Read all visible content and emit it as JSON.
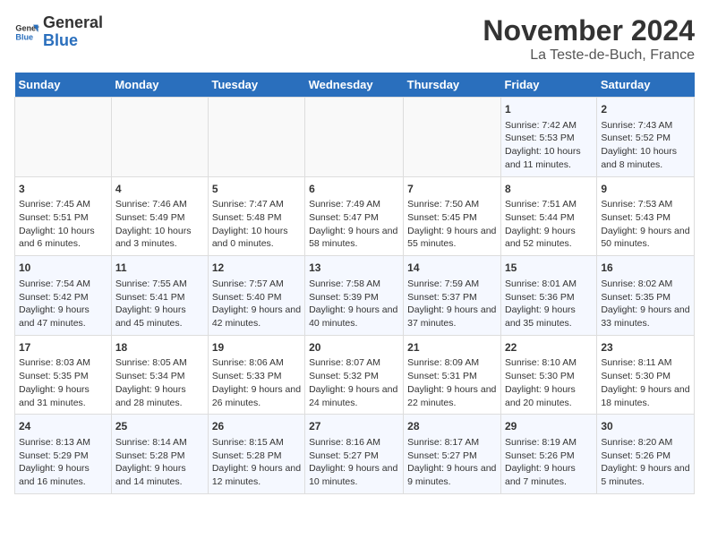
{
  "logo": {
    "line1": "General",
    "line2": "Blue"
  },
  "title": "November 2024",
  "location": "La Teste-de-Buch, France",
  "days_of_week": [
    "Sunday",
    "Monday",
    "Tuesday",
    "Wednesday",
    "Thursday",
    "Friday",
    "Saturday"
  ],
  "weeks": [
    [
      {
        "day": "",
        "content": ""
      },
      {
        "day": "",
        "content": ""
      },
      {
        "day": "",
        "content": ""
      },
      {
        "day": "",
        "content": ""
      },
      {
        "day": "",
        "content": ""
      },
      {
        "day": "1",
        "content": "Sunrise: 7:42 AM\nSunset: 5:53 PM\nDaylight: 10 hours and 11 minutes."
      },
      {
        "day": "2",
        "content": "Sunrise: 7:43 AM\nSunset: 5:52 PM\nDaylight: 10 hours and 8 minutes."
      }
    ],
    [
      {
        "day": "3",
        "content": "Sunrise: 7:45 AM\nSunset: 5:51 PM\nDaylight: 10 hours and 6 minutes."
      },
      {
        "day": "4",
        "content": "Sunrise: 7:46 AM\nSunset: 5:49 PM\nDaylight: 10 hours and 3 minutes."
      },
      {
        "day": "5",
        "content": "Sunrise: 7:47 AM\nSunset: 5:48 PM\nDaylight: 10 hours and 0 minutes."
      },
      {
        "day": "6",
        "content": "Sunrise: 7:49 AM\nSunset: 5:47 PM\nDaylight: 9 hours and 58 minutes."
      },
      {
        "day": "7",
        "content": "Sunrise: 7:50 AM\nSunset: 5:45 PM\nDaylight: 9 hours and 55 minutes."
      },
      {
        "day": "8",
        "content": "Sunrise: 7:51 AM\nSunset: 5:44 PM\nDaylight: 9 hours and 52 minutes."
      },
      {
        "day": "9",
        "content": "Sunrise: 7:53 AM\nSunset: 5:43 PM\nDaylight: 9 hours and 50 minutes."
      }
    ],
    [
      {
        "day": "10",
        "content": "Sunrise: 7:54 AM\nSunset: 5:42 PM\nDaylight: 9 hours and 47 minutes."
      },
      {
        "day": "11",
        "content": "Sunrise: 7:55 AM\nSunset: 5:41 PM\nDaylight: 9 hours and 45 minutes."
      },
      {
        "day": "12",
        "content": "Sunrise: 7:57 AM\nSunset: 5:40 PM\nDaylight: 9 hours and 42 minutes."
      },
      {
        "day": "13",
        "content": "Sunrise: 7:58 AM\nSunset: 5:39 PM\nDaylight: 9 hours and 40 minutes."
      },
      {
        "day": "14",
        "content": "Sunrise: 7:59 AM\nSunset: 5:37 PM\nDaylight: 9 hours and 37 minutes."
      },
      {
        "day": "15",
        "content": "Sunrise: 8:01 AM\nSunset: 5:36 PM\nDaylight: 9 hours and 35 minutes."
      },
      {
        "day": "16",
        "content": "Sunrise: 8:02 AM\nSunset: 5:35 PM\nDaylight: 9 hours and 33 minutes."
      }
    ],
    [
      {
        "day": "17",
        "content": "Sunrise: 8:03 AM\nSunset: 5:35 PM\nDaylight: 9 hours and 31 minutes."
      },
      {
        "day": "18",
        "content": "Sunrise: 8:05 AM\nSunset: 5:34 PM\nDaylight: 9 hours and 28 minutes."
      },
      {
        "day": "19",
        "content": "Sunrise: 8:06 AM\nSunset: 5:33 PM\nDaylight: 9 hours and 26 minutes."
      },
      {
        "day": "20",
        "content": "Sunrise: 8:07 AM\nSunset: 5:32 PM\nDaylight: 9 hours and 24 minutes."
      },
      {
        "day": "21",
        "content": "Sunrise: 8:09 AM\nSunset: 5:31 PM\nDaylight: 9 hours and 22 minutes."
      },
      {
        "day": "22",
        "content": "Sunrise: 8:10 AM\nSunset: 5:30 PM\nDaylight: 9 hours and 20 minutes."
      },
      {
        "day": "23",
        "content": "Sunrise: 8:11 AM\nSunset: 5:30 PM\nDaylight: 9 hours and 18 minutes."
      }
    ],
    [
      {
        "day": "24",
        "content": "Sunrise: 8:13 AM\nSunset: 5:29 PM\nDaylight: 9 hours and 16 minutes."
      },
      {
        "day": "25",
        "content": "Sunrise: 8:14 AM\nSunset: 5:28 PM\nDaylight: 9 hours and 14 minutes."
      },
      {
        "day": "26",
        "content": "Sunrise: 8:15 AM\nSunset: 5:28 PM\nDaylight: 9 hours and 12 minutes."
      },
      {
        "day": "27",
        "content": "Sunrise: 8:16 AM\nSunset: 5:27 PM\nDaylight: 9 hours and 10 minutes."
      },
      {
        "day": "28",
        "content": "Sunrise: 8:17 AM\nSunset: 5:27 PM\nDaylight: 9 hours and 9 minutes."
      },
      {
        "day": "29",
        "content": "Sunrise: 8:19 AM\nSunset: 5:26 PM\nDaylight: 9 hours and 7 minutes."
      },
      {
        "day": "30",
        "content": "Sunrise: 8:20 AM\nSunset: 5:26 PM\nDaylight: 9 hours and 5 minutes."
      }
    ]
  ]
}
